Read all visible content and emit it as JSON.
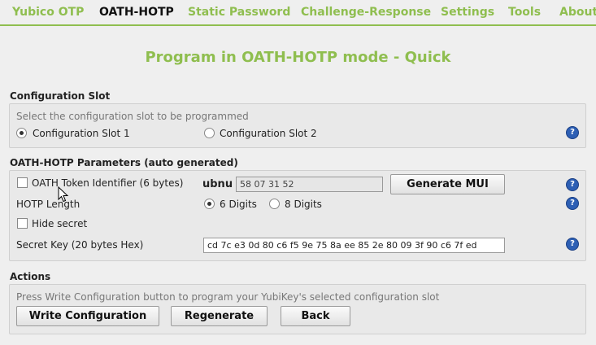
{
  "nav": {
    "items": [
      "Yubico OTP",
      "OATH-HOTP",
      "Static Password",
      "Challenge-Response",
      "Settings",
      "Tools",
      "About"
    ],
    "active": "OATH-HOTP"
  },
  "page": {
    "title": "Program in OATH-HOTP mode - Quick"
  },
  "config_slot": {
    "heading": "Configuration Slot",
    "hint": "Select the configuration slot to be programmed",
    "slot1_label": "Configuration Slot 1",
    "slot2_label": "Configuration Slot 2",
    "selected": "Configuration Slot 1",
    "help": "?"
  },
  "params": {
    "heading": "OATH-HOTP Parameters (auto generated)",
    "token_id_label": "OATH Token Identifier (6 bytes)",
    "token_id_checked": false,
    "prefix": "ubnu",
    "token_value": "58 07 31 52",
    "generate_mui_label": "Generate MUI",
    "hotp_length_label": "HOTP Length",
    "six_digits_label": "6 Digits",
    "eight_digits_label": "8 Digits",
    "selected_length": "6 Digits",
    "hide_secret_label": "Hide secret",
    "hide_secret_checked": false,
    "secret_key_label": "Secret Key (20 bytes Hex)",
    "secret_key_value": "cd 7c e3 0d 80 c6 f5 9e 75 8a ee 85 2e 80 09 3f 90 c6 7f ed",
    "help": "?"
  },
  "actions": {
    "heading": "Actions",
    "hint": "Press Write Configuration button to program your YubiKey's selected configuration slot",
    "write_label": "Write Configuration",
    "regenerate_label": "Regenerate",
    "back_label": "Back"
  },
  "colors": {
    "accent": "#8fbe4f",
    "help_blue": "#2d5fb4",
    "background": "#efefef"
  },
  "icons": {
    "help": "question-circle-icon",
    "cursor": "mouse-pointer-icon"
  }
}
